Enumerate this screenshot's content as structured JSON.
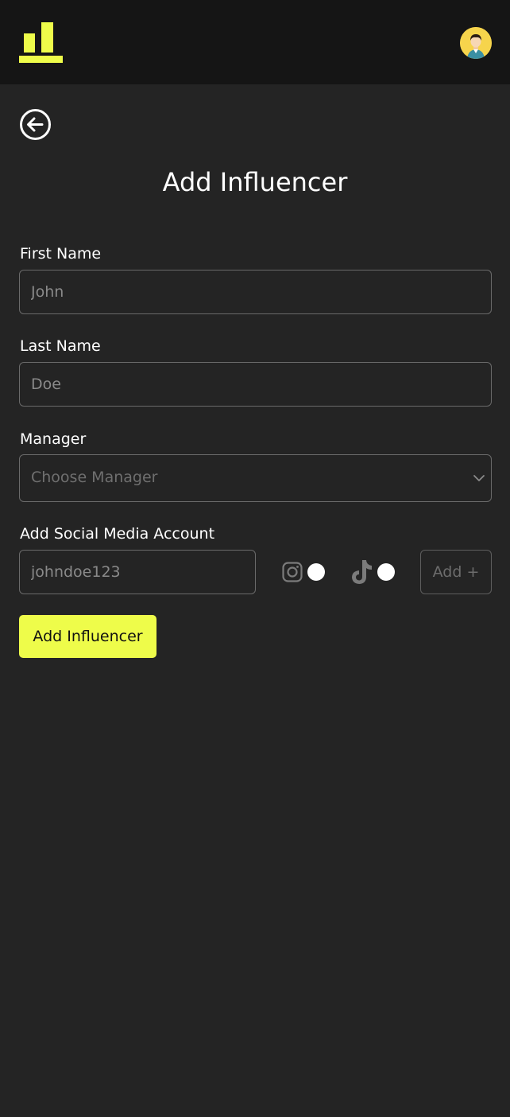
{
  "header": {
    "logo_icon": "bar-chart-logo-icon",
    "avatar_icon": "user-avatar-icon",
    "accent_color": "#eefc4a"
  },
  "page": {
    "back_icon": "arrow-left-circle-icon",
    "title": "Add Influencer"
  },
  "form": {
    "first_name": {
      "label": "First Name",
      "placeholder": "John",
      "value": ""
    },
    "last_name": {
      "label": "Last Name",
      "placeholder": "Doe",
      "value": ""
    },
    "manager": {
      "label": "Manager",
      "placeholder": "Choose Manager",
      "chevron_icon": "chevron-down-icon"
    },
    "social": {
      "label": "Add Social Media Account",
      "placeholder": "johndoe123",
      "platforms": [
        {
          "name": "instagram",
          "icon": "instagram-icon",
          "selected": false
        },
        {
          "name": "tiktok",
          "icon": "tiktok-icon",
          "selected": false
        }
      ],
      "add_label": "Add +"
    },
    "submit_label": "Add Influencer"
  }
}
